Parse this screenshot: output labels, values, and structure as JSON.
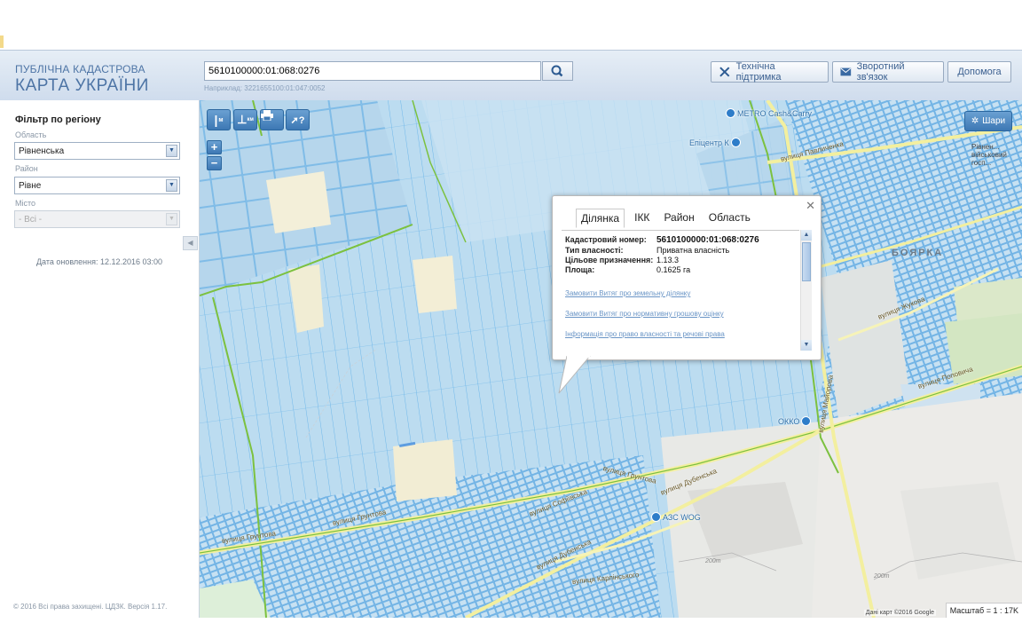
{
  "header": {
    "logo_line1": "ПУБЛІЧНА КАДАСТРОВА",
    "logo_line2": "КАРТА УКРАЇНИ",
    "search_value": "5610100000:01:068:0276",
    "search_hint": "Наприклад: 3221655100:01:047:0052",
    "support_label": "Технічна підтримка",
    "feedback_label": "Зворотний зв'язок",
    "help_label": "Допомога"
  },
  "sidebar": {
    "filter_title": "Фільтр по регіону",
    "oblast_label": "Область",
    "oblast_value": "Рівненська",
    "rayon_label": "Район",
    "rayon_value": "Рівне",
    "city_label": "Місто",
    "city_value": "- Всі -",
    "update_date": "Дата оновлення: 12.12.2016 03:00",
    "copyright": "© 2016 Всі права захищені. ЦДЗК. Версія 1.17."
  },
  "map": {
    "toolbar": [
      "м",
      "км",
      "print",
      "identify"
    ],
    "layers_label": "Шари",
    "labels": {
      "metro": "METRO Cash&Carry",
      "epicentr": "Епіцентр К",
      "okko": "ОККО",
      "azs": "АЗС WOG",
      "boyarka": "БОЯРКА",
      "rivne_military": "Рівнен... військовий госп...",
      "pavlichenka": "вулиця Павличенка",
      "gruntova1": "вулиця Грунтова",
      "gruntova2": "вулиця Грунтова",
      "dubenska1": "вулиця Дубенська",
      "dubenska2": "вулиця Дубенська",
      "sofiivska": "вулиця Софіївська",
      "karpinskoho": "вулиця Карпінського",
      "zhukova": "вулиця Жукова",
      "popovycha": "вулиця Поповича",
      "mayorova": "вулиця Майорова",
      "contour200a": "200m",
      "contour200b": "200m"
    },
    "attribution": "Дані карт ©2016 Google",
    "scale": "Масштаб = 1 : 17K"
  },
  "popup": {
    "tabs": [
      "Ділянка",
      "ІКК",
      "Район",
      "Область"
    ],
    "active_tab": "Ділянка",
    "rows": [
      {
        "k": "Кадастровий номер:",
        "v": "5610100000:01:068:0276"
      },
      {
        "k": "Тип власності:",
        "v": "Приватна власність"
      },
      {
        "k": "Цільове призначення:",
        "v": "1.13.3"
      },
      {
        "k": "Площа:",
        "v": "0.1625 га"
      }
    ],
    "links": [
      "Замовити Витяг про земельну ділянку",
      "Замовити Витяг про нормативну грошову оцінку",
      "Інформація про право власності та речові права"
    ]
  },
  "colors": {
    "header_text": "#4d74a5",
    "parcel_line": "#6fb7ea",
    "map_bg": "#b8d9ee",
    "road": "#f3ef9f",
    "green_border": "#7cc13f",
    "button_blue": "#3d78b4"
  }
}
